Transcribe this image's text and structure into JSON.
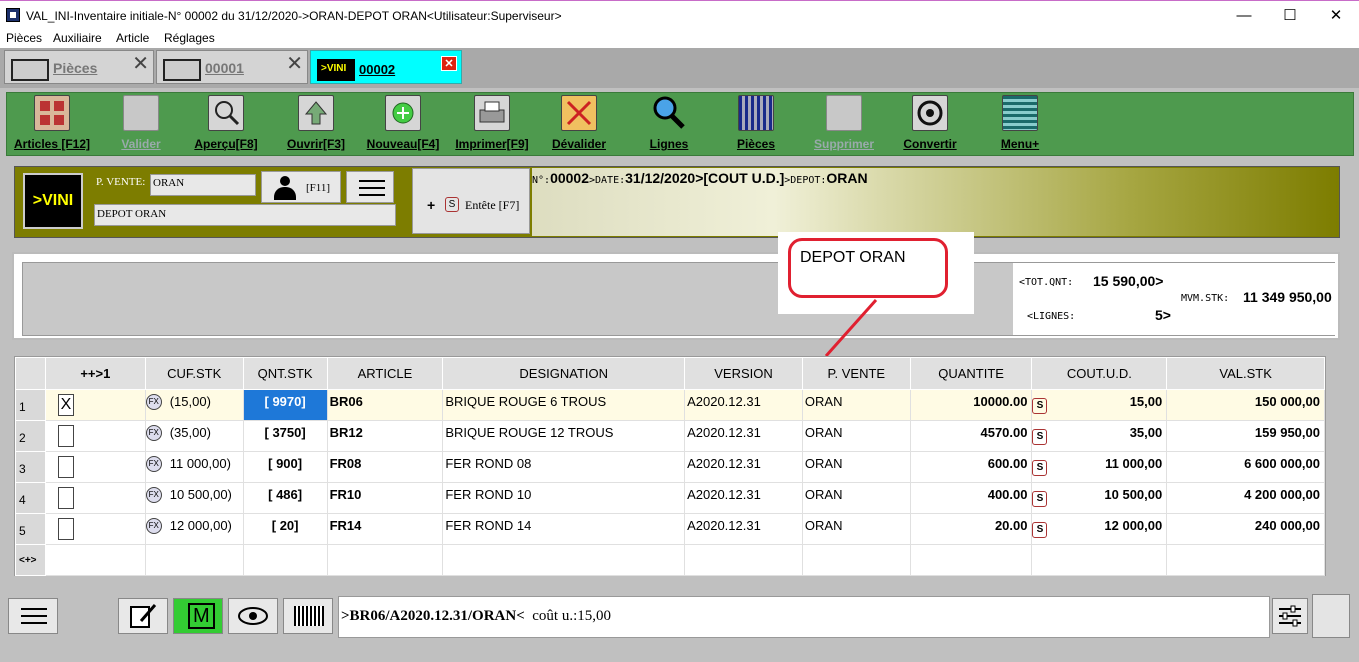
{
  "window": {
    "title": "VAL_INI-Inventaire initiale-N° 00002 du 31/12/2020->ORAN-DEPOT ORAN<Utilisateur:Superviseur>",
    "minimize": "—",
    "maximize": "☐",
    "close": "✕"
  },
  "menu": [
    "Pièces",
    "Auxiliaire",
    "Article",
    "Réglages"
  ],
  "tabs": [
    {
      "label": "Pièces",
      "close": "✕"
    },
    {
      "label": "00001",
      "close": "✕"
    },
    {
      "label": "00002",
      "close": "✕",
      "icon_text": ">VINI"
    }
  ],
  "toolbar": [
    {
      "label": "Articles [F12]",
      "icon": "grid-icon"
    },
    {
      "label": "Valider",
      "icon": "check-icon",
      "disabled": true
    },
    {
      "label": "Aperçu[F8]",
      "icon": "magnifier-icon"
    },
    {
      "label": "Ouvrir[F3]",
      "icon": "open-icon"
    },
    {
      "label": "Nouveau[F4]",
      "icon": "new-icon"
    },
    {
      "label": "Imprimer[F9]",
      "icon": "printer-icon"
    },
    {
      "label": "Dévalider",
      "icon": "unvalidate-icon"
    },
    {
      "label": "Lignes",
      "icon": "search-icon"
    },
    {
      "label": "Pièces",
      "icon": "pieces-icon"
    },
    {
      "label": "Supprimer",
      "icon": "delete-icon",
      "disabled": true
    },
    {
      "label": "Convertir",
      "icon": "convert-icon"
    },
    {
      "label": "Menu+",
      "icon": "menu-icon"
    }
  ],
  "header": {
    "logo": ">VINI",
    "pvente_label": "P. VENTE:",
    "pvente_value": "ORAN",
    "depot": "DEPOT ORAN",
    "user_key": "[F11]",
    "entete_plus": "+",
    "entete_s": "S",
    "entete_label": "Entête [F7]",
    "info": {
      "n_label": "N°:",
      "n_value": "00002",
      "date_label": ">DATE:",
      "date_value": "31/12/2020",
      "cout": ">[COUT U.D.]",
      "depot_label": ">DEPOT:",
      "depot_value": "ORAN"
    }
  },
  "totals": {
    "tot_qnt_label": "<TOT.QNT:",
    "tot_qnt_value": "15 590,00>",
    "lignes_label": "<LIGNES:",
    "lignes_value": "5>",
    "mvm_label": "MVM.STK:",
    "mvm_value": "11 349 950,00"
  },
  "callout": "DEPOT ORAN",
  "grid": {
    "columns": [
      "",
      "++>1",
      "CUF.STK",
      "QNT.STK",
      "ARTICLE",
      "DESIGNATION",
      "VERSION",
      "P. VENTE",
      "QUANTITE",
      "COUT.U.D.",
      "VAL.STK"
    ],
    "footer_row_label": "<+>",
    "rows": [
      {
        "n": "1",
        "checked": "X",
        "cuf": "(15,00)",
        "qnt": "[ 9970]",
        "article": "BR06",
        "designation": "BRIQUE ROUGE 6 TROUS",
        "version": "A2020.12.31",
        "pvente": "ORAN",
        "quantite": "10000.00",
        "cout": "15,00",
        "val": "150 000,00"
      },
      {
        "n": "2",
        "checked": "",
        "cuf": "(35,00)",
        "qnt": "[ 3750]",
        "article": "BR12",
        "designation": "BRIQUE ROUGE 12 TROUS",
        "version": "A2020.12.31",
        "pvente": "ORAN",
        "quantite": "4570.00",
        "cout": "35,00",
        "val": "159 950,00"
      },
      {
        "n": "3",
        "checked": "",
        "cuf": "11 000,00)",
        "qnt": "[ 900]",
        "article": "FR08",
        "designation": "FER ROND 08",
        "version": "A2020.12.31",
        "pvente": "ORAN",
        "quantite": "600.00",
        "cout": "11 000,00",
        "val": "6 600 000,00"
      },
      {
        "n": "4",
        "checked": "",
        "cuf": "10 500,00)",
        "qnt": "[ 486]",
        "article": "FR10",
        "designation": "FER ROND 10",
        "version": "A2020.12.31",
        "pvente": "ORAN",
        "quantite": "400.00",
        "cout": "10 500,00",
        "val": "4 200 000,00"
      },
      {
        "n": "5",
        "checked": "",
        "cuf": "12 000,00)",
        "qnt": "[ 20]",
        "article": "FR14",
        "designation": "FER ROND 14",
        "version": "A2020.12.31",
        "pvente": "ORAN",
        "quantite": "20.00",
        "cout": "12 000,00",
        "val": "240 000,00"
      }
    ],
    "fx_label": "FX",
    "s_label": "S"
  },
  "bottom": {
    "m_label": "M",
    "status_main": ">BR06/A2020.12.31/ORAN<",
    "status_cout": "coût u.:15,00"
  }
}
